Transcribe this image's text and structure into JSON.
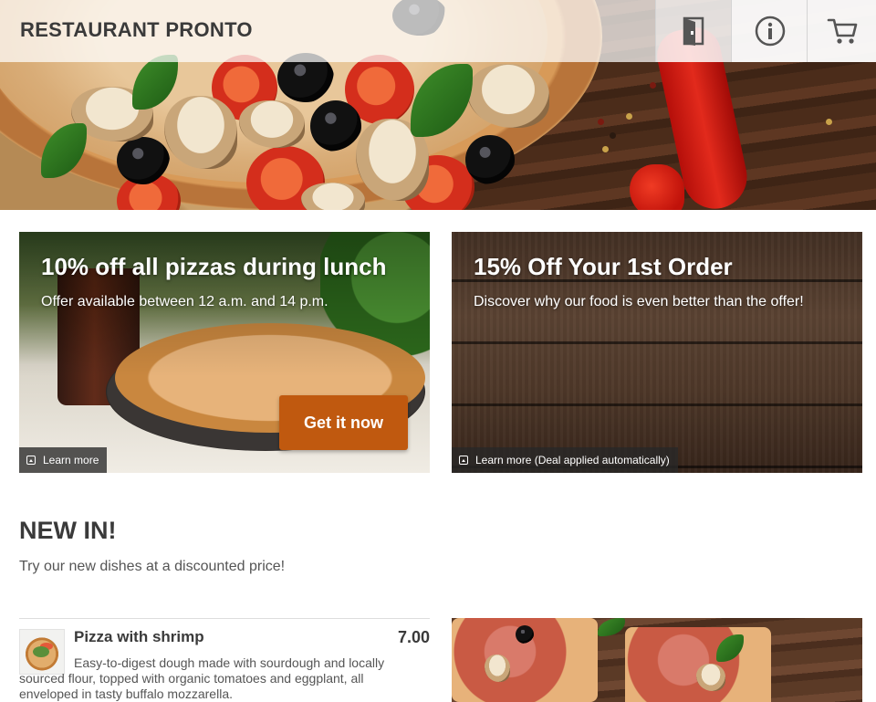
{
  "header": {
    "brand": "RESTAURANT PRONTO",
    "buttons": [
      {
        "icon": "door-exit-icon"
      },
      {
        "icon": "info-icon"
      },
      {
        "icon": "cart-icon"
      }
    ]
  },
  "promos": [
    {
      "title": "10% off all pizzas during lunch",
      "subtitle": "Offer available between 12 a.m. and 14 p.m.",
      "cta": "Get it now",
      "learn_more": "Learn more",
      "cta_color": "#c0590f"
    },
    {
      "title": "15% Off Your 1st Order",
      "subtitle": "Discover why our food is even better than the offer!",
      "learn_more": "Learn more (Deal applied automatically)"
    }
  ],
  "new_in": {
    "title": "NEW IN!",
    "subtitle": "Try our new dishes at a discounted price!",
    "items": [
      {
        "name": "Pizza with shrimp",
        "price": "7.00",
        "description": "Easy-to-digest dough made with sourdough and locally sourced flour, topped with organic tomatoes and eggplant, all enveloped in tasty buffalo mozzarella."
      }
    ]
  }
}
